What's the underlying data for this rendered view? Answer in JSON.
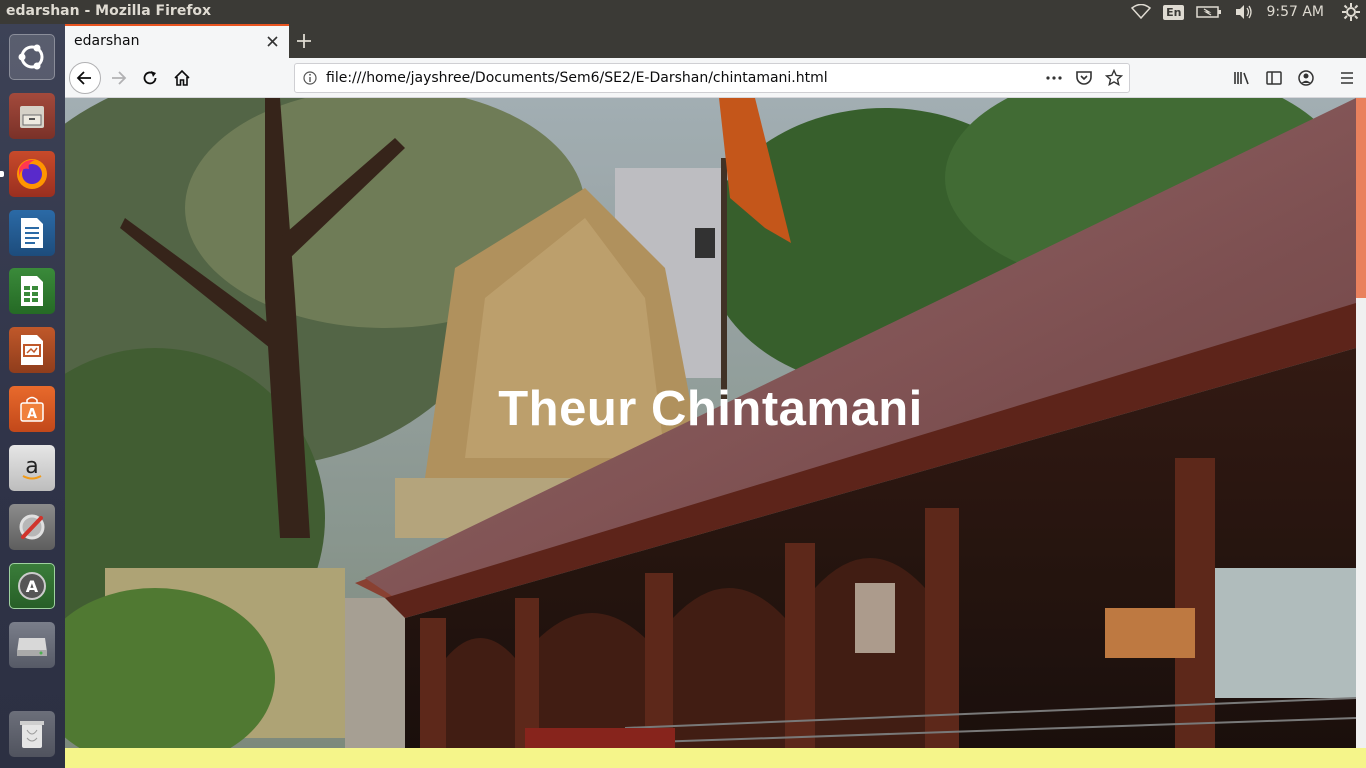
{
  "top_panel": {
    "window_title": "edarshan - Mozilla Firefox",
    "keyboard_layout": "En",
    "clock": "9:57 AM",
    "icons": [
      "wifi-icon",
      "keyboard-icon",
      "battery-icon",
      "volume-icon",
      "settings-gear-icon"
    ]
  },
  "launcher": {
    "items": [
      {
        "name": "ubuntu-dash"
      },
      {
        "name": "files"
      },
      {
        "name": "firefox"
      },
      {
        "name": "libreoffice-writer"
      },
      {
        "name": "libreoffice-calc"
      },
      {
        "name": "libreoffice-impress"
      },
      {
        "name": "ubuntu-software"
      },
      {
        "name": "amazon"
      },
      {
        "name": "system-settings"
      },
      {
        "name": "software-updater"
      },
      {
        "name": "disk-drive"
      },
      {
        "name": "trash"
      }
    ]
  },
  "browser": {
    "tab": {
      "title": "edarshan"
    },
    "url": "file:///home/jayshree/Documents/Sem6/SE2/E-Darshan/chintamani.html"
  },
  "page": {
    "hero_title": "Theur Chintamani"
  },
  "colors": {
    "accent": "#e95420",
    "below_hero": "#f5f58a",
    "scroll_thumb": "#e9815d"
  }
}
